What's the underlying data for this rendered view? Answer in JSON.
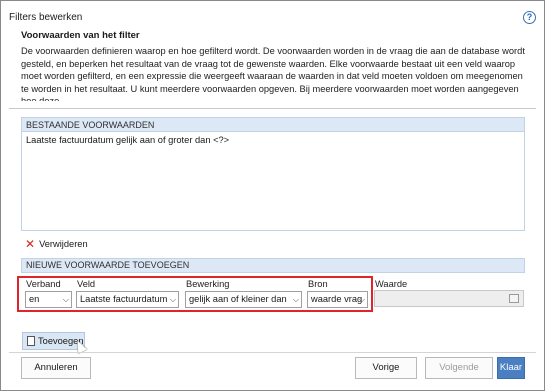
{
  "window": {
    "title": "Filters bewerken",
    "help_symbol": "?"
  },
  "heading": "Voorwaarden van het filter",
  "description": "De voorwaarden definieren waarop en hoe gefilterd wordt. De voorwaarden worden in de vraag die aan de database wordt gesteld, en beperken het resultaat van de vraag tot de gewenste waarden. Elke voorwaarde bestaat uit een veld waarop moet worden gefilterd, en een expressie die weergeeft waaraan de waarden in dat veld moeten voldoen om meegenomen te worden in het resultaat. U kunt meerdere voorwaarden opgeven. Bij meerdere voorwaarden moet worden aangegeven hoe deze",
  "existing": {
    "header": "BESTAANDE VOORWAARDEN",
    "items": [
      "Laatste factuurdatum gelijk aan of groter dan <?>"
    ]
  },
  "delete_label": "Verwijderen",
  "new_condition": {
    "header": "NIEUWE VOORWAARDE TOEVOEGEN",
    "verband": {
      "label": "Verband",
      "value": "en"
    },
    "veld": {
      "label": "Veld",
      "value": "Laatste factuurdatum"
    },
    "bewerking": {
      "label": "Bewerking",
      "value": "gelijk aan of kleiner dan"
    },
    "bron": {
      "label": "Bron",
      "value": "waarde vrag"
    },
    "waarde": {
      "label": "Waarde",
      "value": ""
    }
  },
  "add_label": "Toevoegen",
  "buttons": {
    "cancel": "Annuleren",
    "prev": "Vorige",
    "next": "Volgende",
    "finish": "Klaar"
  },
  "colors": {
    "highlight": "#e0242c",
    "header_bg": "#dce8f6",
    "primary": "#4a7fc1"
  }
}
